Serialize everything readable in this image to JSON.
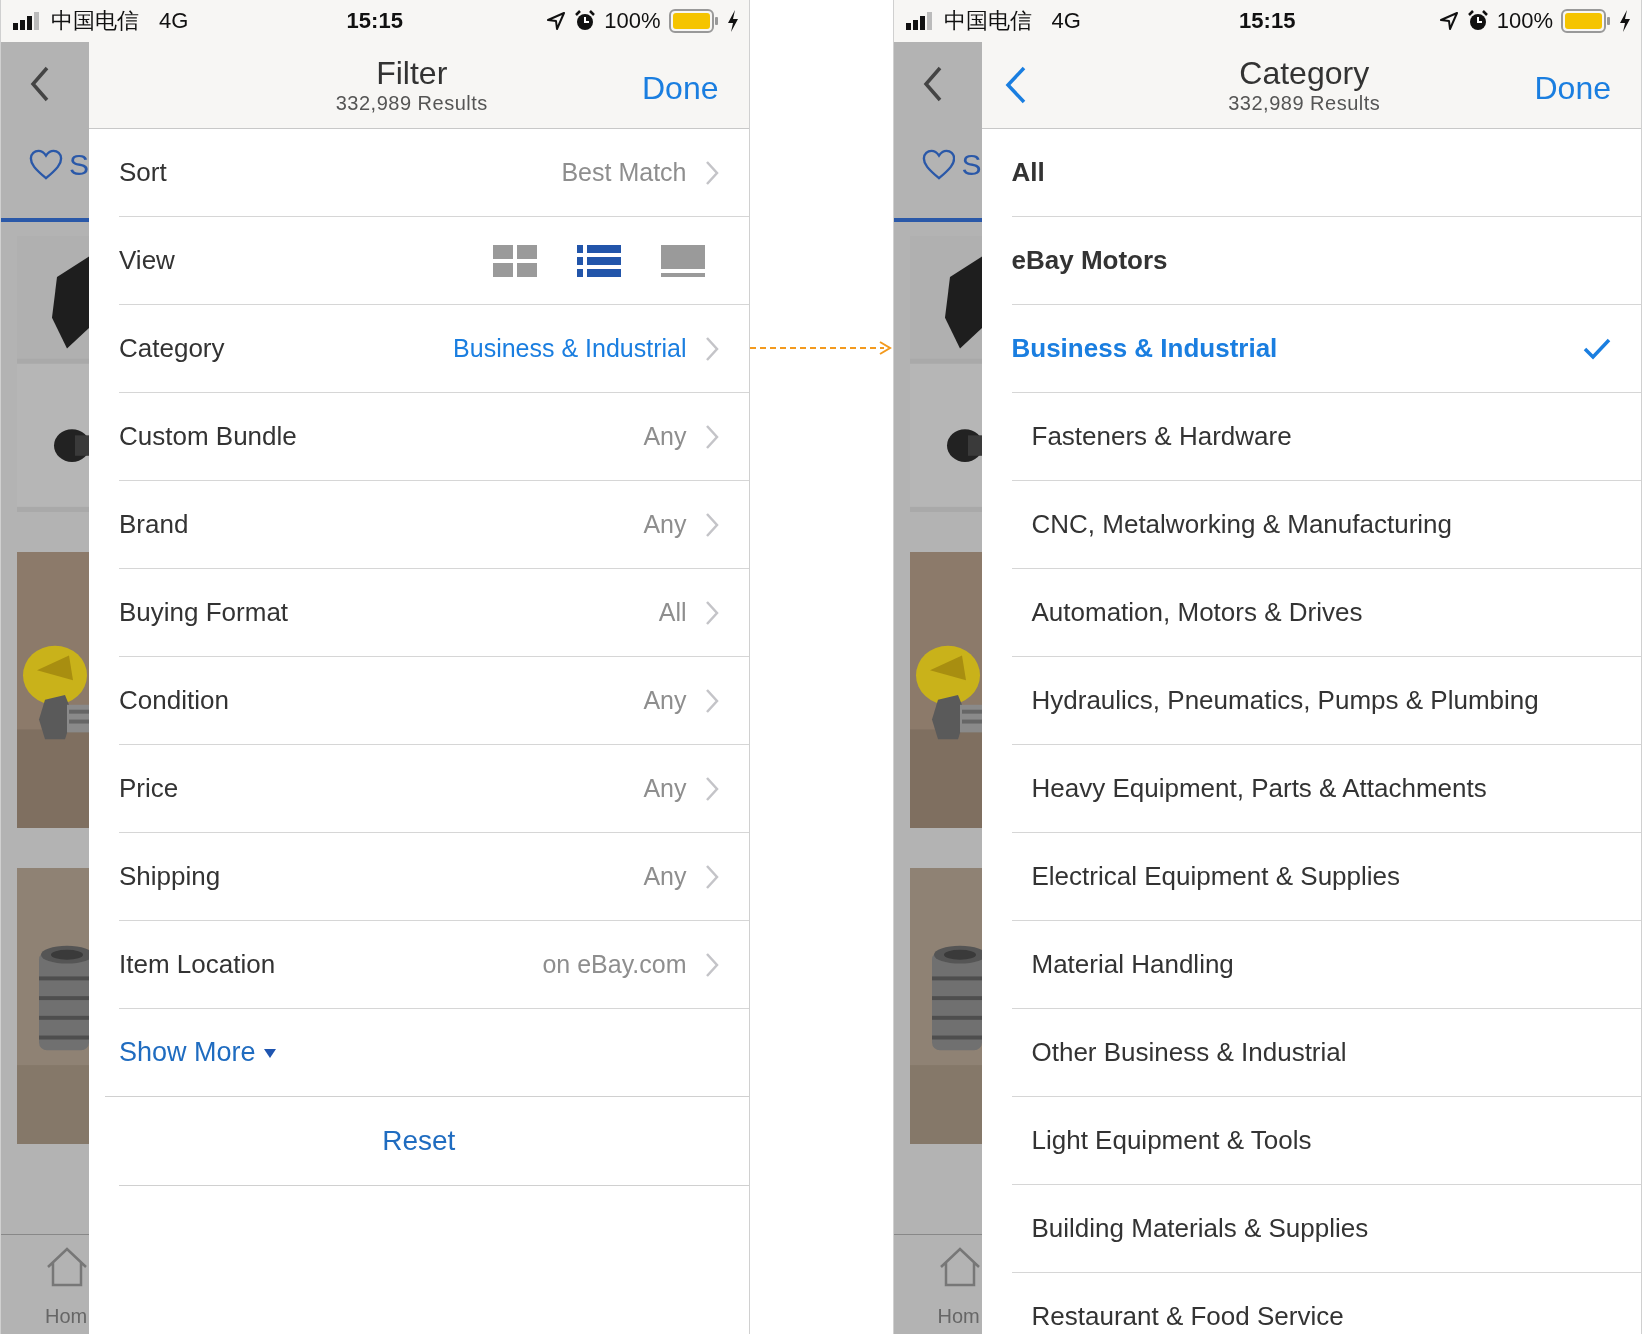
{
  "phones": [
    {
      "status_bar": {
        "carrier": "中国电信",
        "network": "4G",
        "time": "15:15",
        "battery": "100%"
      },
      "background": {
        "tab_label": "S",
        "home_label": "Hom"
      },
      "sheet": {
        "kind": "filter",
        "title": "Filter",
        "subtitle": "332,989 Results",
        "done": "Done",
        "rows": [
          {
            "kind": "value",
            "label": "Sort",
            "value": "Best Match",
            "active": false
          },
          {
            "kind": "view",
            "label": "View",
            "options": [
              {
                "kind": "grid",
                "selected": false
              },
              {
                "kind": "list",
                "selected": true
              },
              {
                "kind": "gallery",
                "selected": false
              }
            ]
          },
          {
            "kind": "value",
            "label": "Category",
            "value": "Business & Industrial",
            "active": true
          },
          {
            "kind": "value",
            "label": "Custom Bundle",
            "value": "Any",
            "active": false
          },
          {
            "kind": "value",
            "label": "Brand",
            "value": "Any",
            "active": false
          },
          {
            "kind": "value",
            "label": "Buying Format",
            "value": "All",
            "active": false
          },
          {
            "kind": "value",
            "label": "Condition",
            "value": "Any",
            "active": false
          },
          {
            "kind": "value",
            "label": "Price",
            "value": "Any",
            "active": false
          },
          {
            "kind": "value",
            "label": "Shipping",
            "value": "Any",
            "active": false
          },
          {
            "kind": "value",
            "label": "Item Location",
            "value": "on eBay.com",
            "active": false
          }
        ],
        "show_more": "Show More",
        "reset": "Reset"
      }
    },
    {
      "status_bar": {
        "carrier": "中国电信",
        "network": "4G",
        "time": "15:15",
        "battery": "100%"
      },
      "background": {
        "tab_label": "S",
        "home_label": "Hom"
      },
      "sheet": {
        "kind": "category",
        "title": "Category",
        "subtitle": "332,989 Results",
        "done": "Done",
        "items": [
          {
            "kind": "top",
            "label": "All",
            "selected": false
          },
          {
            "kind": "top",
            "label": "eBay Motors",
            "selected": false
          },
          {
            "kind": "top",
            "label": "Business & Industrial",
            "selected": true
          },
          {
            "kind": "sub",
            "label": "Fasteners & Hardware",
            "selected": false
          },
          {
            "kind": "sub",
            "label": "CNC, Metalworking & Manufacturing",
            "selected": false
          },
          {
            "kind": "sub",
            "label": "Automation, Motors & Drives",
            "selected": false
          },
          {
            "kind": "sub",
            "label": "Hydraulics, Pneumatics, Pumps & Plumbing",
            "selected": false
          },
          {
            "kind": "sub",
            "label": "Heavy Equipment, Parts & Attachments",
            "selected": false
          },
          {
            "kind": "sub",
            "label": "Electrical Equipment & Supplies",
            "selected": false
          },
          {
            "kind": "sub",
            "label": "Material Handling",
            "selected": false
          },
          {
            "kind": "sub",
            "label": "Other Business & Industrial",
            "selected": false
          },
          {
            "kind": "sub",
            "label": "Light Equipment & Tools",
            "selected": false
          },
          {
            "kind": "sub",
            "label": "Building Materials & Supplies",
            "selected": false
          },
          {
            "kind": "sub",
            "label": "Restaurant & Food Service",
            "selected": false
          }
        ]
      }
    }
  ]
}
